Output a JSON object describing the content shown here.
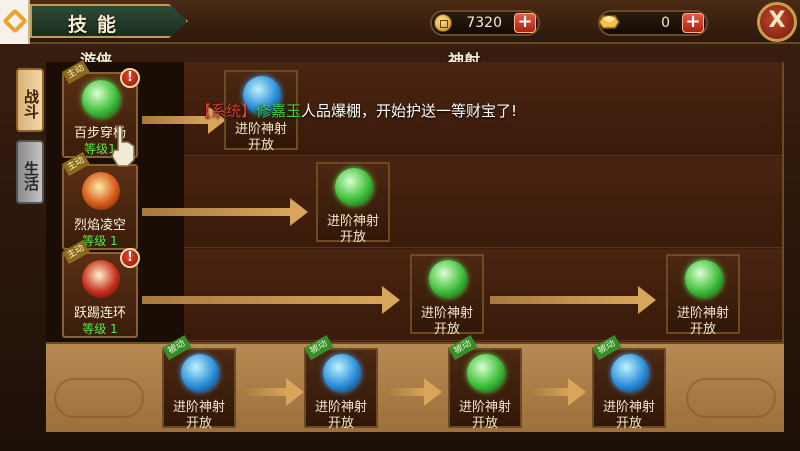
{
  "header": {
    "title": "技能",
    "copper": "7320",
    "gold": "0",
    "plus_label": "+",
    "close_label": "X"
  },
  "columns": {
    "left": "游侠",
    "right": "神射"
  },
  "side_tabs": [
    {
      "label": "战斗",
      "active": true
    },
    {
      "label": "生活",
      "active": false
    }
  ],
  "banner": {
    "system": "【系统】",
    "player": "修嘉玉",
    "message": "人品爆棚，开始护送一等财宝了!"
  },
  "skills": [
    {
      "tag": "主动",
      "name": "百步穿杨",
      "level": "等级1",
      "alert": "!"
    },
    {
      "tag": "主动",
      "name": "烈焰凌空",
      "level": "等级 1"
    },
    {
      "tag": "主动",
      "name": "跃踢连环",
      "level": "等级 1",
      "alert": "!"
    }
  ],
  "advanced": {
    "line1": "进阶神射",
    "line2": "开放",
    "passive_tag": "被动"
  },
  "icons": {
    "copper": "copper-coin-icon",
    "gold": "gold-ingot-icon",
    "close": "close-icon",
    "pointer": "hand-pointer-icon"
  }
}
